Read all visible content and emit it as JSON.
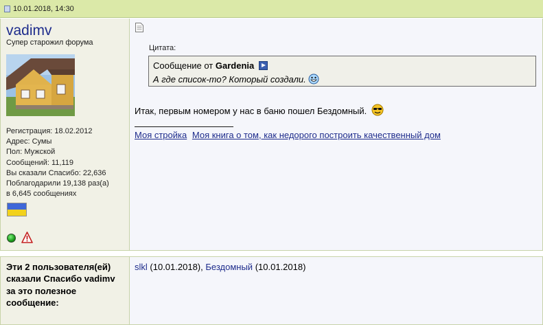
{
  "post": {
    "date": "10.01.2018, 14:30"
  },
  "user": {
    "name": "vadimv",
    "title": "Супер старожил форума",
    "stats": [
      "Регистрация: 18.02.2012",
      "Адрес: Сумы",
      "Пол: Мужской",
      "Сообщений: 11,119",
      "Вы сказали Спасибо: 22,636",
      "Поблагодарили 19,138 раз(а)",
      "в 6,645 сообщениях"
    ]
  },
  "quote": {
    "label": "Цитата:",
    "prefix": "Сообщение от",
    "author": "Gardenia",
    "text": "А где список-то? Который создали."
  },
  "message": "Итак, первым номером у нас в баню пошел Бездомный.",
  "signature": {
    "links": [
      "Моя стройка",
      "Моя книга о том, как недорого построить качественный дом"
    ]
  },
  "thanks": {
    "label": "Эти 2 пользователя(ей) сказали Спасибо vadimv за это полезное сообщение:",
    "entries": [
      {
        "name": "slkl",
        "date": "(10.01.2018),"
      },
      {
        "name": "Бездомный",
        "date": "(10.01.2018)"
      }
    ]
  },
  "colors": {
    "header_bg": "#dbe9a8",
    "link": "#1e2c8c",
    "user_col_bg": "#f1f1e6",
    "post_bg": "#f5f6fb"
  }
}
